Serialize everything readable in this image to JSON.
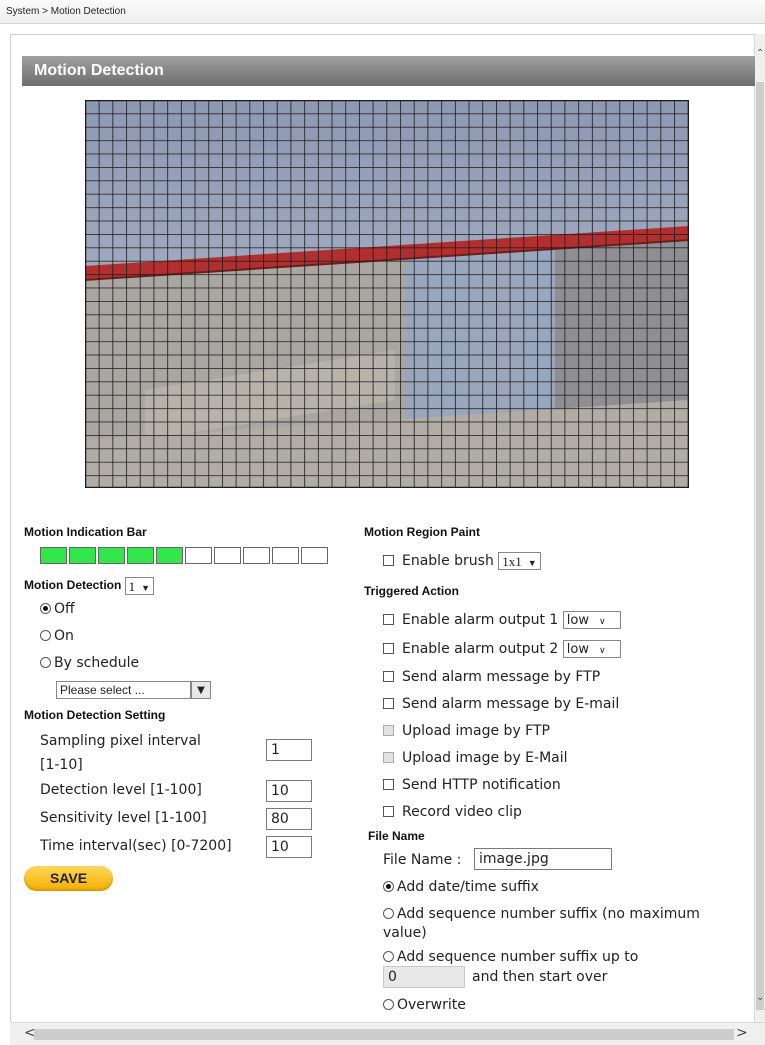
{
  "breadcrumb": "System > Motion Detection",
  "panel_title": "Motion Detection",
  "colors": {
    "active_bar": "#33e64c",
    "accent_red": "#b82a2a",
    "button": "#f5b800"
  },
  "motion_indication_bar": {
    "label": "Motion Indication Bar",
    "segments": 10,
    "active": 5
  },
  "motion_detection": {
    "label": "Motion Detection",
    "select_value": "1",
    "options": {
      "off": "Off",
      "on": "On",
      "schedule": "By schedule"
    },
    "selected": "off",
    "schedule_placeholder": "Please select ..."
  },
  "settings": {
    "title": "Motion Detection Setting",
    "sampling_label_1": "Sampling pixel interval",
    "sampling_label_2": "[1-10]",
    "sampling_value": "1",
    "detection_label": "Detection level [1-100]",
    "detection_value": "10",
    "sensitivity_label": "Sensitivity level [1-100]",
    "sensitivity_value": "80",
    "time_label": "Time interval(sec) [0-7200]",
    "time_value": "10"
  },
  "save_label": "SAVE",
  "region_paint": {
    "title": "Motion Region Paint",
    "enable_brush": "Enable brush",
    "brush_size": "1x1"
  },
  "triggered": {
    "title": "Triggered Action",
    "alarm1": "Enable alarm output 1",
    "alarm1_value": "low",
    "alarm2": "Enable alarm output 2",
    "alarm2_value": "low",
    "ftp_msg": "Send alarm message by FTP",
    "email_msg": "Send alarm message by E-mail",
    "upload_ftp": "Upload image by FTP",
    "upload_email": "Upload image by E-Mail",
    "http": "Send HTTP notification",
    "record": "Record video clip"
  },
  "file_name": {
    "title": "File Name",
    "label": "File Name :",
    "value": "image.jpg",
    "opt_datetime": "Add date/time suffix",
    "opt_seq_1": "Add sequence number suffix (no maximum",
    "opt_seq_2": "value)",
    "opt_seq_upto": "Add sequence number suffix up to",
    "seq_value": "0",
    "then_over": "and then start over",
    "overwrite": "Overwrite"
  }
}
